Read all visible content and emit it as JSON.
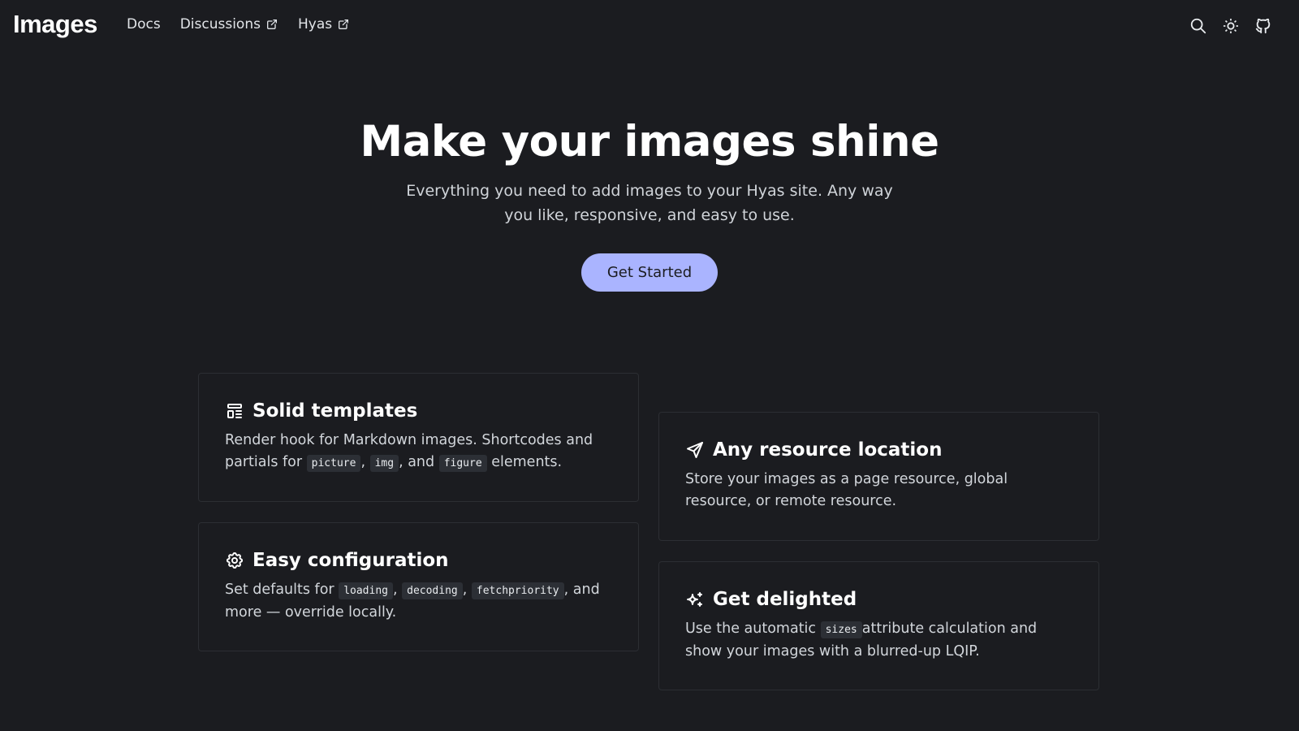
{
  "header": {
    "brand": "Images",
    "links": [
      {
        "label": "Docs",
        "external": false
      },
      {
        "label": "Discussions",
        "external": true
      },
      {
        "label": "Hyas",
        "external": true
      }
    ],
    "icons": [
      "search-icon",
      "sun-icon",
      "github-icon"
    ]
  },
  "hero": {
    "title": "Make your images shine",
    "subtitle": "Everything you need to add images to your Hyas site. Any way you like, responsive, and easy to use.",
    "cta": "Get Started"
  },
  "features": {
    "solid": {
      "title": "Solid templates",
      "icon": "template-icon",
      "text1": "Render hook for Markdown images. Shortcodes and partials for ",
      "code1": "picture",
      "sep1": ", ",
      "code2": "img",
      "sep2": ", and ",
      "code3": "figure",
      "text2": " elements."
    },
    "resource": {
      "title": "Any resource location",
      "icon": "send-icon",
      "text": "Store your images as a page resource, global resource, or remote resource."
    },
    "config": {
      "title": "Easy configuration",
      "icon": "gear-icon",
      "text1": "Set defaults for ",
      "code1": "loading",
      "sep1": ", ",
      "code2": "decoding",
      "sep2": ", ",
      "code3": "fetchpriority",
      "text2": ", and more — override locally."
    },
    "delighted": {
      "title": "Get delighted",
      "icon": "sparkles-icon",
      "text1": "Use the automatic ",
      "code1": "sizes",
      "text2": "attribute calculation and show your images with a blurred-up LQIP."
    }
  },
  "colors": {
    "background": "#1b1c20",
    "accent": "#aab4ff",
    "card_border": "#2c2e33"
  }
}
